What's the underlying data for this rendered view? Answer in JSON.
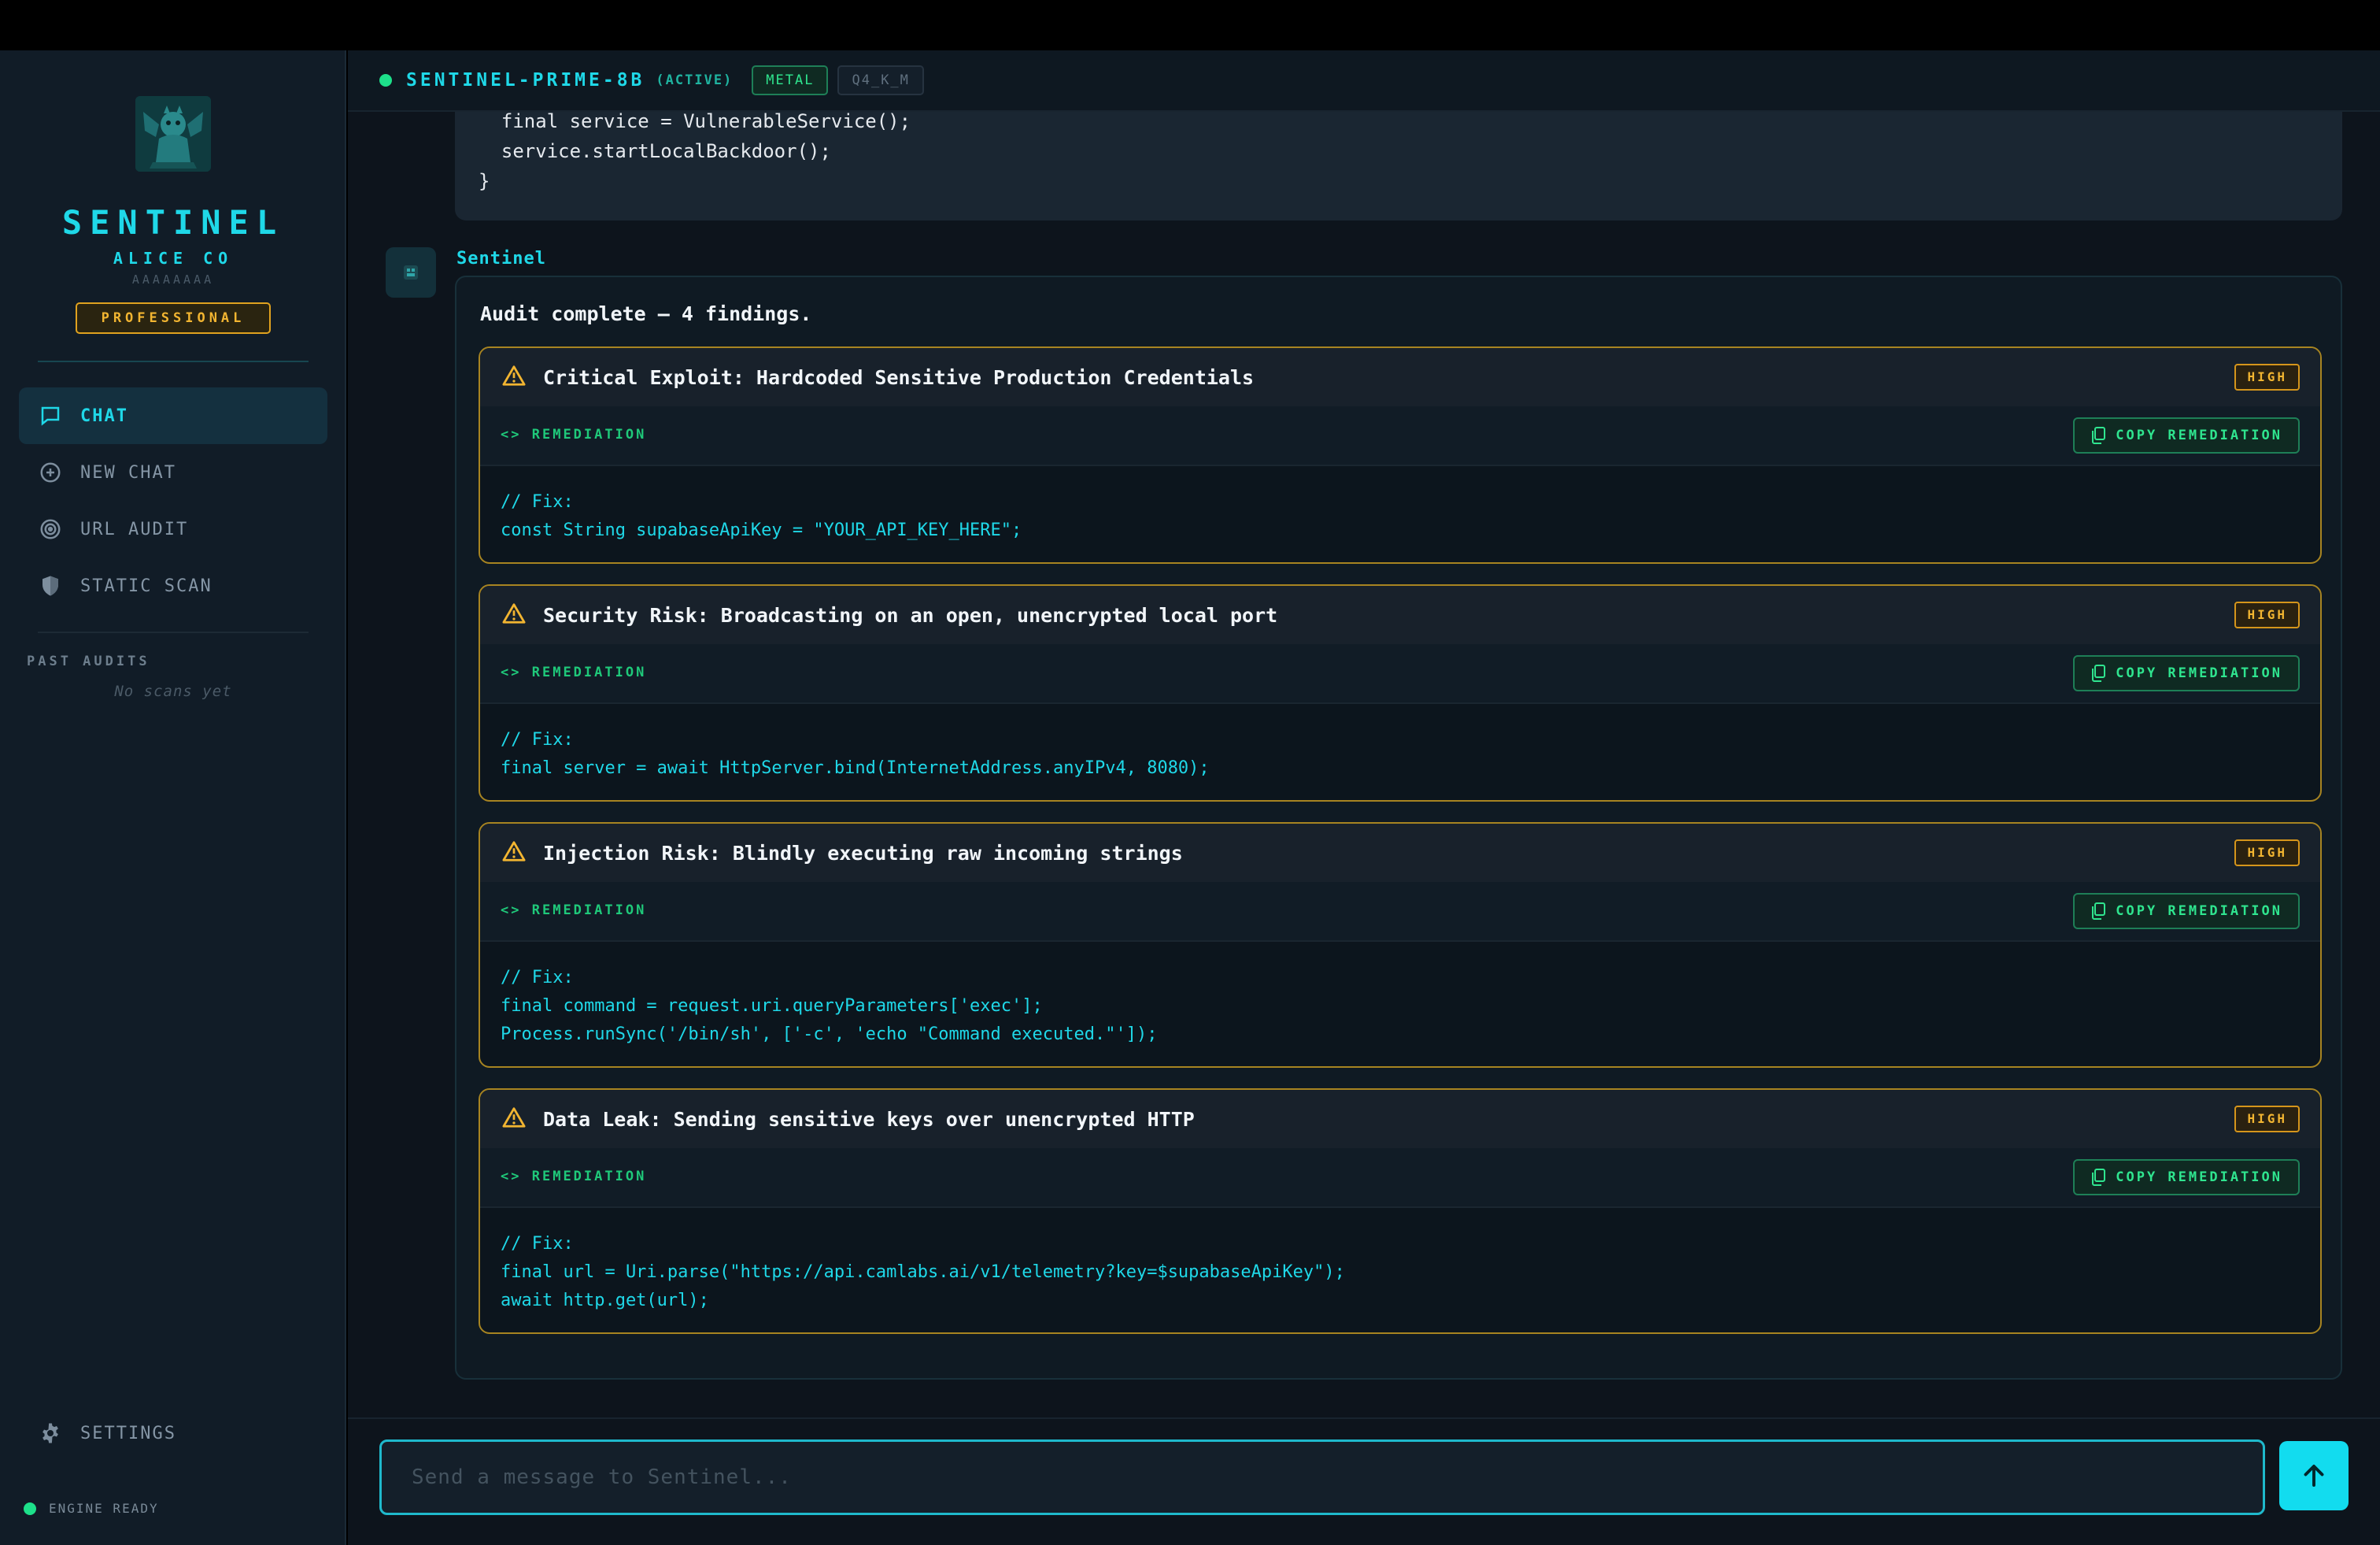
{
  "sidebar": {
    "brand_title": "SENTINEL",
    "org_name": "ALICE CO",
    "org_id": "AAAAAAAA",
    "plan_badge": "PROFESSIONAL",
    "nav": [
      {
        "label": "CHAT",
        "icon": "chat-bubble-icon",
        "active": true
      },
      {
        "label": "NEW CHAT",
        "icon": "plus-circle-icon",
        "active": false
      },
      {
        "label": "URL AUDIT",
        "icon": "target-icon",
        "active": false
      },
      {
        "label": "STATIC SCAN",
        "icon": "shield-icon",
        "active": false
      }
    ],
    "past_audits_label": "PAST AUDITS",
    "past_audits_empty": "No scans yet",
    "settings_label": "SETTINGS",
    "engine_status": "ENGINE READY"
  },
  "header": {
    "model_name": "SENTINEL-PRIME-8B",
    "model_status": "(ACTIVE)",
    "backend_chip": "METAL",
    "quant_chip": "Q4_K_M"
  },
  "previous_code": [
    "  final service = VulnerableService();",
    "  service.startLocalBackdoor();",
    "}"
  ],
  "reply": {
    "sender": "Sentinel",
    "summary": "Audit complete — 4 findings.",
    "remediation_label": "REMEDIATION",
    "copy_label": "COPY REMEDIATION",
    "findings": [
      {
        "title": "Critical Exploit: Hardcoded Sensitive Production Credentials",
        "severity": "HIGH",
        "code": [
          "// Fix:",
          "const String supabaseApiKey = \"YOUR_API_KEY_HERE\";"
        ]
      },
      {
        "title": "Security Risk: Broadcasting on an open, unencrypted local port",
        "severity": "HIGH",
        "code": [
          "// Fix:",
          "final server = await HttpServer.bind(InternetAddress.anyIPv4, 8080);"
        ]
      },
      {
        "title": "Injection Risk: Blindly executing raw incoming strings",
        "severity": "HIGH",
        "code": [
          "// Fix:",
          "final command = request.uri.queryParameters['exec'];",
          "Process.runSync('/bin/sh', ['-c', 'echo \"Command executed.\"']);"
        ]
      },
      {
        "title": "Data Leak: Sending sensitive keys over unencrypted HTTP",
        "severity": "HIGH",
        "code": [
          "// Fix:",
          "final url = Uri.parse(\"https://api.camlabs.ai/v1/telemetry?key=$supabaseApiKey\");",
          "await http.get(url);"
        ]
      }
    ]
  },
  "composer": {
    "placeholder": "Send a message to Sentinel...",
    "value": ""
  },
  "colors": {
    "accent": "#1fd8e8",
    "success": "#1de08a",
    "warning": "#f2b531",
    "background": "#0d141c",
    "sidebar": "#111c27"
  }
}
